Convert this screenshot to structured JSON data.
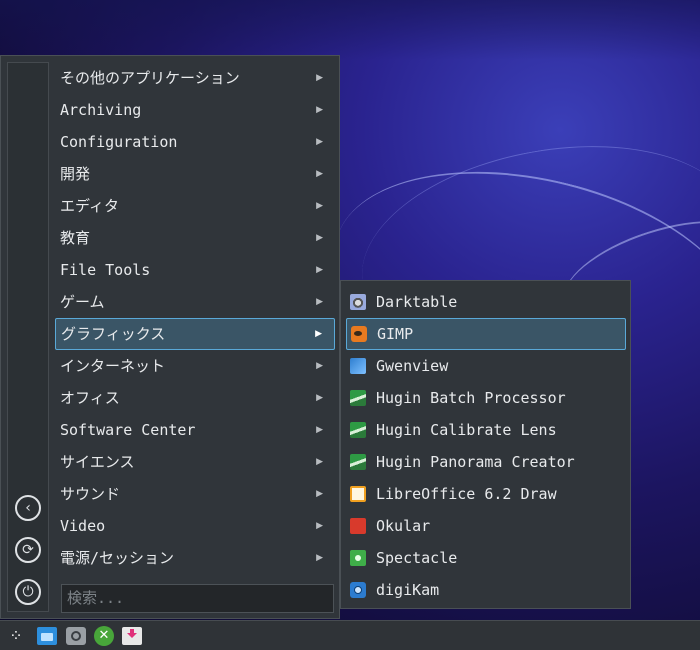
{
  "main_menu": {
    "items": [
      {
        "label": "その他のアプリケーション",
        "active": false
      },
      {
        "label": "Archiving",
        "active": false
      },
      {
        "label": "Configuration",
        "active": false
      },
      {
        "label": "開発",
        "active": false
      },
      {
        "label": "エディタ",
        "active": false
      },
      {
        "label": "教育",
        "active": false
      },
      {
        "label": "File Tools",
        "active": false
      },
      {
        "label": "ゲーム",
        "active": false
      },
      {
        "label": "グラフィックス",
        "active": true
      },
      {
        "label": "インターネット",
        "active": false
      },
      {
        "label": "オフィス",
        "active": false
      },
      {
        "label": "Software Center",
        "active": false
      },
      {
        "label": "サイエンス",
        "active": false
      },
      {
        "label": "サウンド",
        "active": false
      },
      {
        "label": "Video",
        "active": false
      },
      {
        "label": "電源/セッション",
        "active": false
      }
    ],
    "arrow_glyph": "▶",
    "search_placeholder": "検索..."
  },
  "side_buttons": [
    {
      "icon": "back-icon",
      "glyph": "‹"
    },
    {
      "icon": "refresh-icon",
      "glyph": "⟳"
    },
    {
      "icon": "power-icon",
      "glyph": "⏻"
    }
  ],
  "sub_menu": {
    "items": [
      {
        "label": "Darktable",
        "icon": "darktable-icon",
        "active": false
      },
      {
        "label": "GIMP",
        "icon": "gimp-icon",
        "active": true
      },
      {
        "label": "Gwenview",
        "icon": "gwenview-icon",
        "active": false
      },
      {
        "label": "Hugin Batch Processor",
        "icon": "hugin-icon",
        "active": false
      },
      {
        "label": "Hugin Calibrate Lens",
        "icon": "hugin-icon",
        "active": false
      },
      {
        "label": "Hugin Panorama Creator",
        "icon": "hugin-icon",
        "active": false
      },
      {
        "label": "LibreOffice 6.2 Draw",
        "icon": "libreoffice-draw-icon",
        "active": false
      },
      {
        "label": "Okular",
        "icon": "okular-icon",
        "active": false
      },
      {
        "label": "Spectacle",
        "icon": "spectacle-icon",
        "active": false
      },
      {
        "label": "digiKam",
        "icon": "digikam-icon",
        "active": false
      }
    ]
  },
  "taskbar": {
    "icons": [
      "launcher-icon",
      "file-manager-icon",
      "settings-icon",
      "game-icon",
      "download-icon"
    ]
  },
  "colors": {
    "panel_bg": "#30353a",
    "highlight_bg": "#3a5566",
    "highlight_border": "#5aa9d8",
    "text": "#e8eaec"
  }
}
